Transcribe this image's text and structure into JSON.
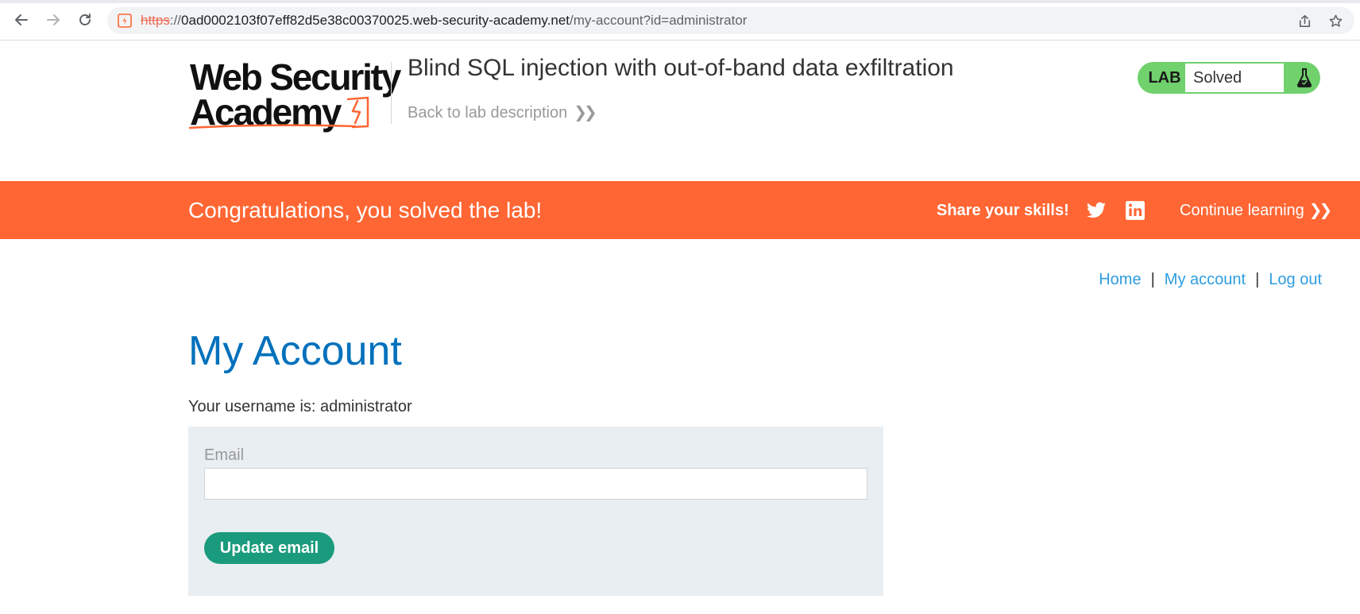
{
  "browser": {
    "url_scheme": "https",
    "url_sep": "://",
    "url_host": "0ad0002103f07eff82d5e38c00370025.web-security-academy.net",
    "url_path": "/my-account?id=administrator"
  },
  "header": {
    "logo_line1": "Web Security",
    "logo_line2": "Academy",
    "lab_title": "Blind SQL injection with out-of-band data exfiltration",
    "back_link": "Back to lab description",
    "lab_badge": "LAB",
    "lab_status": "Solved"
  },
  "notification": {
    "message": "Congratulations, you solved the lab!",
    "share": "Share your skills!",
    "continue": "Continue learning"
  },
  "nav": {
    "home": "Home",
    "sep1": "|",
    "my_account": "My account",
    "sep2": "|",
    "log_out": "Log out"
  },
  "account": {
    "title": "My Account",
    "username_line": "Your username is: administrator",
    "email_label": "Email",
    "email_value": "",
    "update_button": "Update email"
  },
  "colors": {
    "notification_bg": "#ff6633",
    "link": "#2d9de0",
    "title": "#0071bc",
    "button": "#1a9b7d",
    "lab_solved": "#70d16d"
  },
  "icons": [
    "back-icon",
    "forward-icon",
    "reload-icon",
    "site-info-icon",
    "share-page-icon",
    "bookmark-star-icon",
    "flask-icon",
    "twitter-icon",
    "linkedin-icon"
  ]
}
